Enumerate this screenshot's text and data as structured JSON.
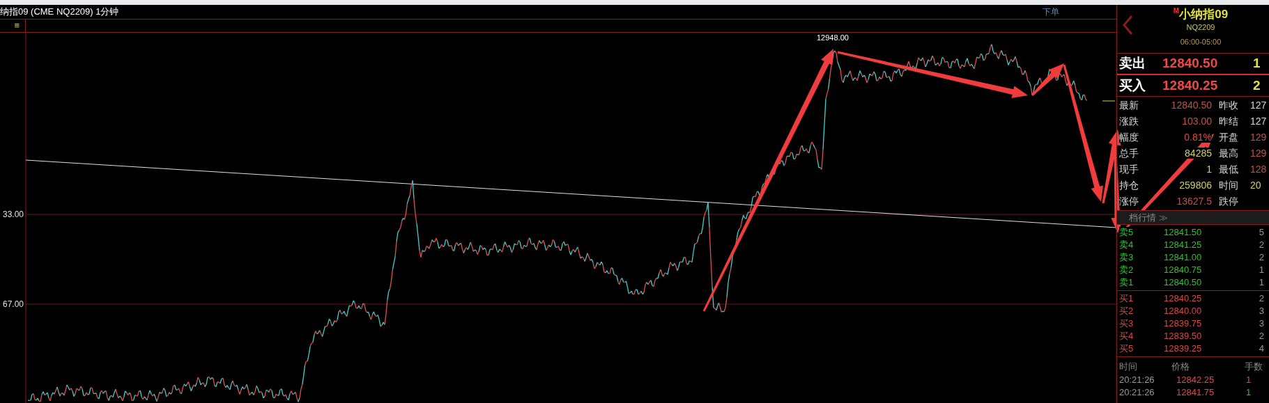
{
  "window": {
    "title": "纳指09 (CME NQ2209) 1分钟"
  },
  "toolbar": {
    "menu": "≡",
    "order_link": "下单"
  },
  "chart": {
    "peak_label": "12948.00",
    "axis_labels": [
      "33.00",
      "67.00"
    ]
  },
  "quote": {
    "mark": "M",
    "name": "小纳指09",
    "code": "NQ2209",
    "session": "06:00-05:00",
    "ask": {
      "label": "卖出",
      "price": "12840.50",
      "size": "1"
    },
    "bid": {
      "label": "买入",
      "price": "12840.25",
      "size": "2"
    },
    "stats": [
      {
        "label": "最新",
        "value": "12840.50",
        "color": "#c0504d"
      },
      {
        "label": "昨收",
        "value": "127",
        "color": "#d8d8d8"
      },
      {
        "label": "涨跌",
        "value": "103.00",
        "color": "#c0504d"
      },
      {
        "label": "昨结",
        "value": "127",
        "color": "#d8d8d8"
      },
      {
        "label": "幅度",
        "value": "0.81%",
        "color": "#e04848"
      },
      {
        "label": "开盘",
        "value": "129",
        "color": "#c0504d"
      },
      {
        "label": "总手",
        "value": "84285",
        "color": "#d0d060"
      },
      {
        "label": "最高",
        "value": "129",
        "color": "#c0504d"
      },
      {
        "label": "现手",
        "value": "1",
        "color": "#d0d060"
      },
      {
        "label": "最低",
        "value": "128",
        "color": "#c0504d"
      },
      {
        "label": "持仓",
        "value": "259806",
        "color": "#d0d060"
      },
      {
        "label": "时间",
        "value": "20",
        "color": "#d0d060"
      },
      {
        "label": "涨停",
        "value": "13627.5",
        "color": "#c0504d"
      },
      {
        "label": "跌停"
      }
    ],
    "depth_header": "档行情 ≫",
    "asks": [
      {
        "level": "卖5",
        "price": "12841.50",
        "size": "5"
      },
      {
        "level": "卖4",
        "price": "12841.25",
        "size": "2"
      },
      {
        "level": "卖3",
        "price": "12841.00",
        "size": "2"
      },
      {
        "level": "卖2",
        "price": "12840.75",
        "size": "1"
      },
      {
        "level": "卖1",
        "price": "12840.50",
        "size": "1"
      }
    ],
    "bids": [
      {
        "level": "买1",
        "price": "12840.25",
        "size": "2"
      },
      {
        "level": "买2",
        "price": "12840.00",
        "size": "3"
      },
      {
        "level": "买3",
        "price": "12839.75",
        "size": "3"
      },
      {
        "level": "买4",
        "price": "12839.50",
        "size": "2"
      },
      {
        "level": "买5",
        "price": "12839.25",
        "size": "4"
      }
    ],
    "trades_columns": [
      "时间",
      "价格",
      "手数"
    ],
    "trades": [
      {
        "time": "20:21:26",
        "price": "12842.25",
        "size": "1",
        "color": "#e04848"
      },
      {
        "time": "20:21:26",
        "price": "12841.75",
        "size": "1",
        "color": "#30c030"
      }
    ]
  }
}
